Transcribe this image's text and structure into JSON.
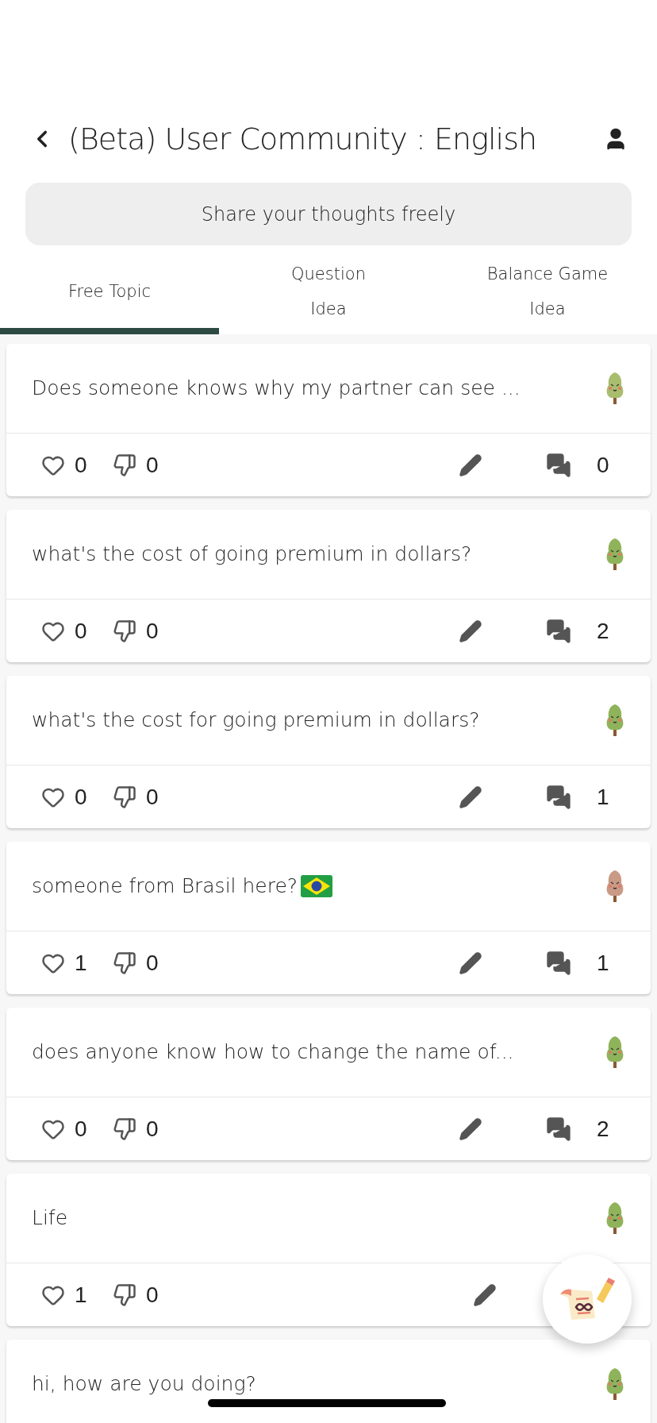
{
  "header": {
    "title": "(Beta) User Community : English"
  },
  "share_bar": {
    "label": "Share your thoughts freely"
  },
  "tabs": [
    {
      "lines": [
        "Free Topic"
      ],
      "selected": true
    },
    {
      "lines": [
        "Question",
        "Idea"
      ],
      "selected": false
    },
    {
      "lines": [
        "Balance Game",
        "Idea"
      ],
      "selected": false
    }
  ],
  "posts": [
    {
      "text": "Does someone knows why my partner can see ...",
      "likes": "0",
      "dislikes": "0",
      "comments": "0",
      "color": "#a9bd6e",
      "flag": false
    },
    {
      "text": "what's the cost of going premium in dollars?",
      "likes": "0",
      "dislikes": "0",
      "comments": "2",
      "color": "#8fb35a",
      "flag": false
    },
    {
      "text": "what's the cost for going premium in dollars?",
      "likes": "0",
      "dislikes": "0",
      "comments": "1",
      "color": "#8fb35a",
      "flag": false
    },
    {
      "text": "someone from Brasil here?",
      "likes": "1",
      "dislikes": "0",
      "comments": "1",
      "color": "#c99a85",
      "flag": true
    },
    {
      "text": "does anyone know how to change the name of...",
      "likes": "0",
      "dislikes": "0",
      "comments": "2",
      "color": "#8fb35a",
      "flag": false
    },
    {
      "text": "Life",
      "likes": "1",
      "dislikes": "0",
      "color": "#8fb35a",
      "flag": false
    },
    {
      "text": "hi, how are you doing?",
      "color": "#8fb35a",
      "flag": false
    }
  ]
}
